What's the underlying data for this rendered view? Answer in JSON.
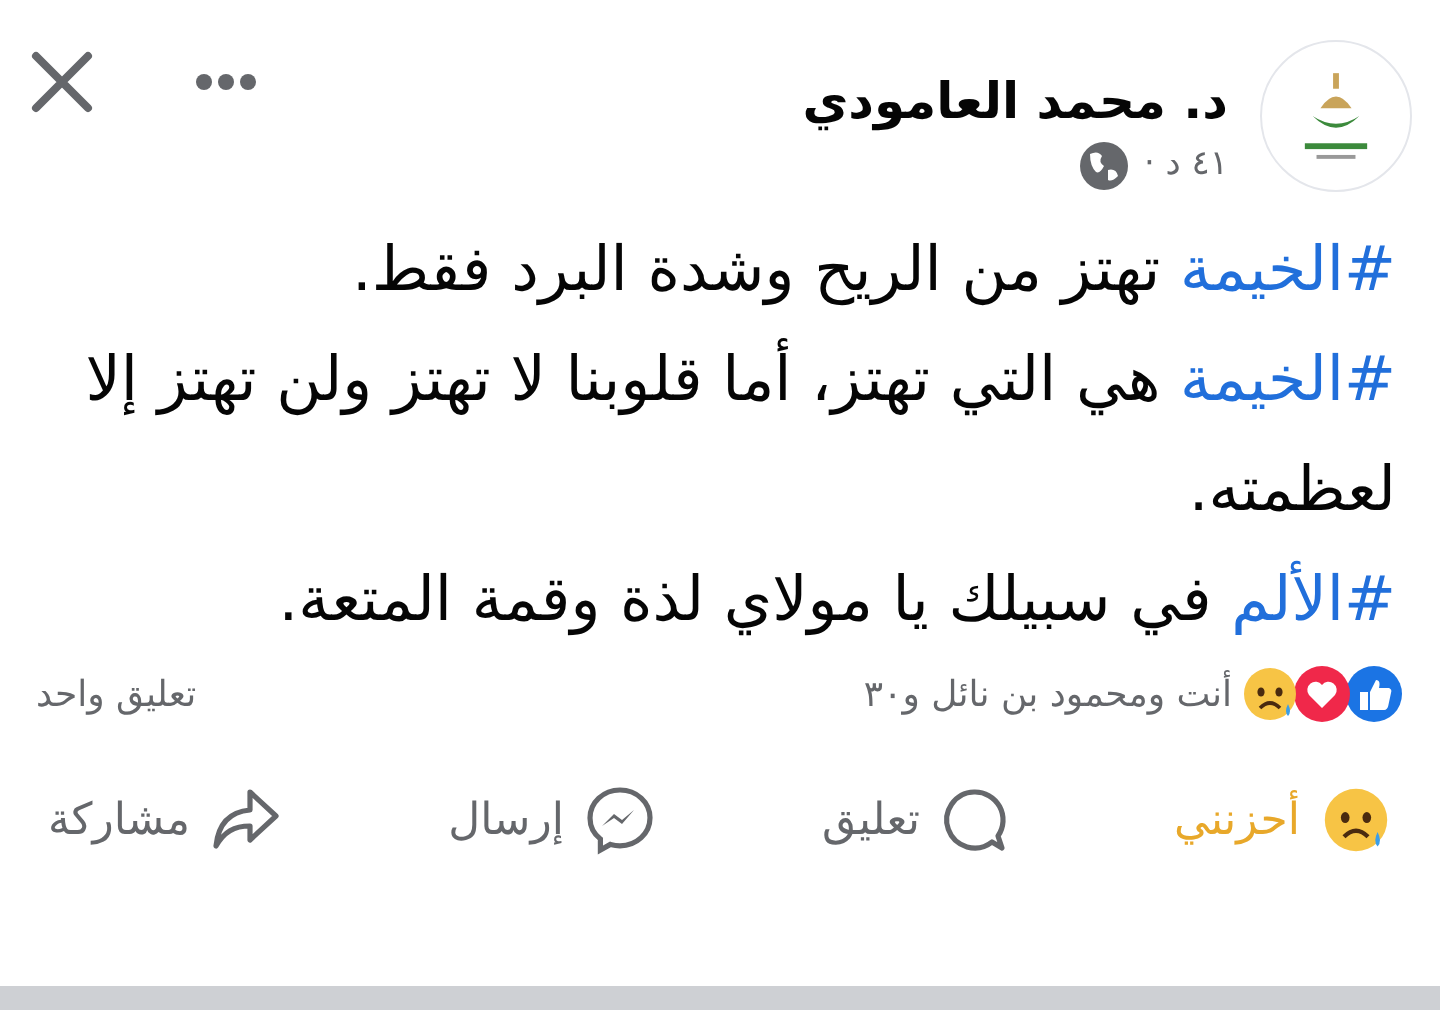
{
  "post": {
    "author": "د. محمد العامودي",
    "time": "٤١ د ·",
    "paragraphs": [
      {
        "hashtag": "#الخيمة",
        "text": "تهتز من الريح وشدة البرد فقط."
      },
      {
        "hashtag": "#الخيمة",
        "text": "هي التي تهتز، أما قلوبنا لا تهتز ولن تهتز إلا لعظمته."
      },
      {
        "hashtag": "#الألم",
        "text": "في سبيلك يا مولاي لذة وقمة المتعة."
      }
    ],
    "reactions": [
      {
        "kind": "like"
      },
      {
        "kind": "love"
      },
      {
        "kind": "sad"
      }
    ],
    "reaction_summary": "أنت ومحمود بن نائل و٣٠",
    "comment_count": "تعليق واحد",
    "actions": [
      {
        "kind": "sad",
        "label": "أحزنني",
        "selected": true
      },
      {
        "kind": "comment",
        "label": "تعليق",
        "selected": false
      },
      {
        "kind": "send",
        "label": "إرسال",
        "selected": false
      },
      {
        "kind": "share",
        "label": "مشاركة",
        "selected": false
      }
    ]
  }
}
